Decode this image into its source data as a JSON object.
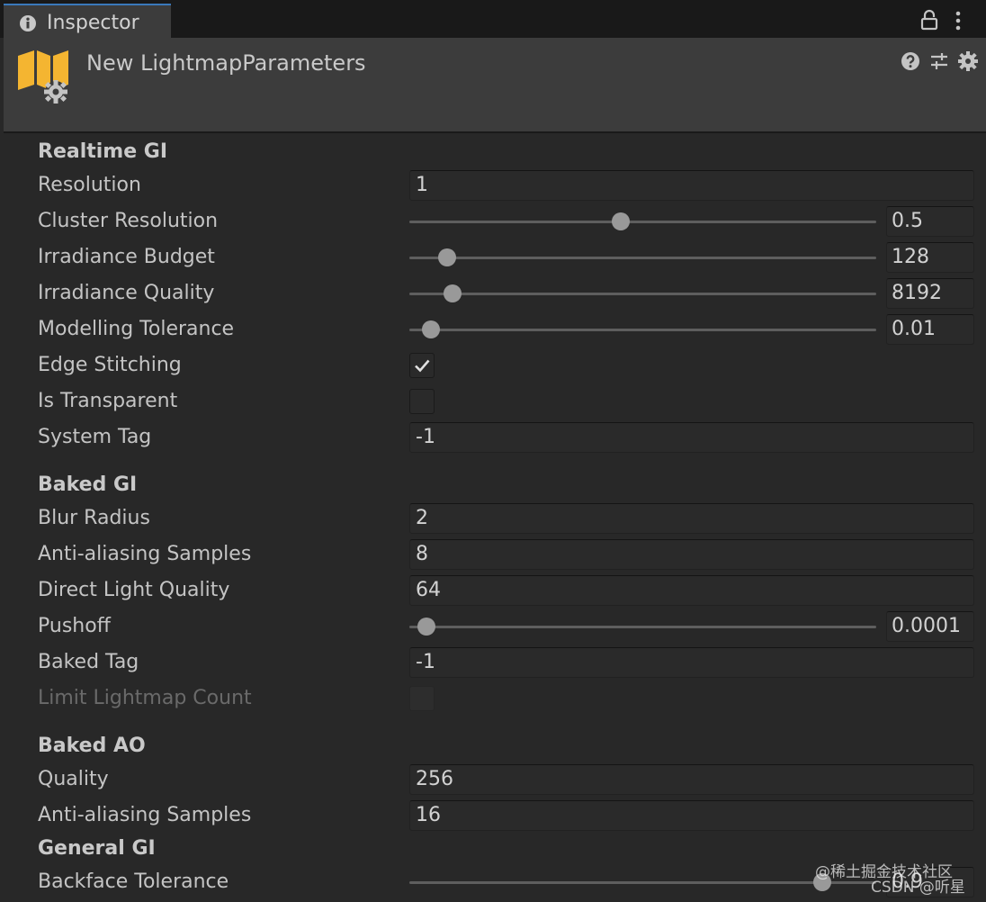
{
  "window": {
    "tab_label": "Inspector",
    "tab_icon": "info-icon",
    "lock_icon": "lock-icon",
    "menu_icon": "kebab-icon"
  },
  "header": {
    "asset_title": "New LightmapParameters",
    "asset_icon": "lightmap-parameters-icon",
    "toolbar_icons": [
      "help-icon",
      "preset-icon",
      "gear-icon"
    ]
  },
  "realtime_gi": {
    "title": "Realtime GI",
    "resolution": {
      "label": "Resolution",
      "value": "1"
    },
    "cluster_resolution": {
      "label": "Cluster Resolution",
      "value": "0.5",
      "level": 0.45
    },
    "irradiance_budget": {
      "label": "Irradiance Budget",
      "value": "128",
      "level": 0.065
    },
    "irradiance_quality": {
      "label": "Irradiance Quality",
      "value": "8192",
      "level": 0.077
    },
    "modelling_tolerance": {
      "label": "Modelling Tolerance",
      "value": "0.01",
      "level": 0.029
    },
    "edge_stitching": {
      "label": "Edge Stitching",
      "checked": true
    },
    "is_transparent": {
      "label": "Is Transparent",
      "checked": false
    },
    "system_tag": {
      "label": "System Tag",
      "value": "-1"
    }
  },
  "baked_gi": {
    "title": "Baked GI",
    "blur_radius": {
      "label": "Blur Radius",
      "value": "2"
    },
    "anti_aliasing_samples": {
      "label": "Anti-aliasing Samples",
      "value": "8"
    },
    "direct_light_quality": {
      "label": "Direct Light Quality",
      "value": "64"
    },
    "pushoff": {
      "label": "Pushoff",
      "value": "0.0001",
      "level": 0.018
    },
    "baked_tag": {
      "label": "Baked Tag",
      "value": "-1"
    },
    "limit_lightmap_count": {
      "label": "Limit Lightmap Count",
      "checked": false,
      "disabled": true
    }
  },
  "baked_ao": {
    "title": "Baked AO",
    "quality": {
      "label": "Quality",
      "value": "256"
    },
    "anti_aliasing_samples": {
      "label": "Anti-aliasing Samples",
      "value": "16"
    }
  },
  "general_gi": {
    "title": "General GI",
    "backface_tolerance": {
      "label": "Backface Tolerance",
      "value": "0.9",
      "level": 0.9
    }
  },
  "watermark": {
    "line1": "@稀土掘金技术社区",
    "line2": "CSDN @听星"
  },
  "colors": {
    "tab_accent": "#3a79bb",
    "asset_icon": "#f4b531",
    "panel_bg": "#282828",
    "field_bg": "#2a2a2a"
  }
}
